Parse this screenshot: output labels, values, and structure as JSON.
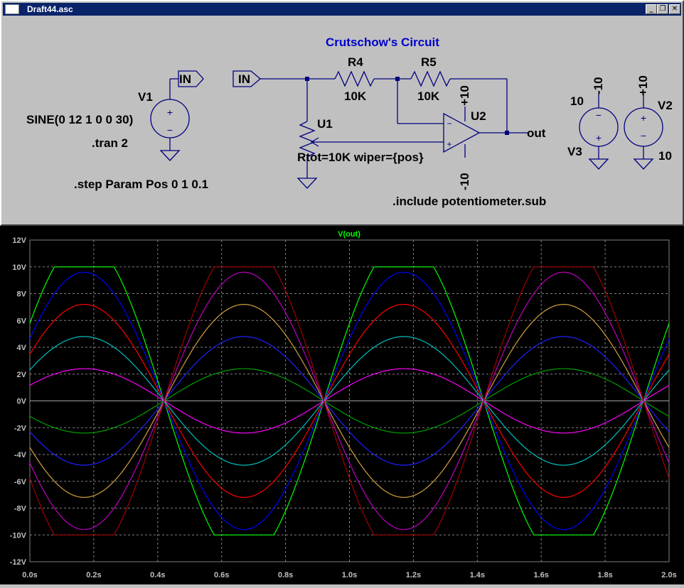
{
  "window": {
    "title": "Draft44.asc",
    "minimize_glyph": "_",
    "restore_glyph": "❐",
    "close_glyph": "✕"
  },
  "schematic": {
    "heading": "Crutschow's Circuit",
    "v1_label": "V1",
    "v1_value": "SINE(0 12 1 0 0 30)",
    "tran": ".tran 2",
    "step": ".step Param Pos 0 1 0.1",
    "in_label_1": "IN",
    "in_label_2": "IN",
    "r4_label": "R4",
    "r4_value": "10K",
    "r5_label": "R5",
    "r5_value": "10K",
    "u1_label": "U1",
    "u1_params": "Rtot=10K wiper={pos}",
    "u2_label": "U2",
    "opamp_plus_supply": "+10",
    "opamp_minus_supply": "-10",
    "opamp_minus_pin": "−",
    "opamp_plus_pin": "+",
    "out_label": "out",
    "include": ".include potentiometer.sub",
    "v3_label": "V3",
    "v3_value": "10",
    "v3_node": "-10",
    "v2_label": "V2",
    "v2_value": "10",
    "v2_node": "+10",
    "src_plus": "+",
    "src_minus": "−"
  },
  "colors": {
    "wire": "#000080",
    "component": "#000080",
    "heading": "#0000cc",
    "plot_bg": "#000000",
    "grid": "#808080",
    "trace_title": "#00ff00"
  },
  "chart_data": {
    "type": "line",
    "title": "V(out)",
    "xlabel": "",
    "ylabel": "",
    "xlim": [
      0,
      2
    ],
    "ylim": [
      -12,
      12
    ],
    "x_ticks": [
      "0.0s",
      "0.2s",
      "0.4s",
      "0.6s",
      "0.8s",
      "1.0s",
      "1.2s",
      "1.4s",
      "1.6s",
      "1.8s",
      "2.0s"
    ],
    "y_ticks": [
      "12V",
      "10V",
      "8V",
      "6V",
      "4V",
      "2V",
      "0V",
      "-2V",
      "-4V",
      "-6V",
      "-8V",
      "-10V",
      "-12V"
    ],
    "grid": true,
    "waveform": "sine",
    "frequency_hz": 1,
    "phase_zero_crossing_s": 0.42,
    "clip_limit_v": 10,
    "series": [
      {
        "amplitude": 12.0,
        "color": "#00ff00"
      },
      {
        "amplitude": 9.6,
        "color": "#0000ff"
      },
      {
        "amplitude": 7.2,
        "color": "#ff0000"
      },
      {
        "amplitude": 4.8,
        "color": "#00c0c0"
      },
      {
        "amplitude": 2.4,
        "color": "#ff00ff"
      },
      {
        "amplitude": -2.4,
        "color": "#00a000"
      },
      {
        "amplitude": -4.8,
        "color": "#2020ff"
      },
      {
        "amplitude": -7.2,
        "color": "#d0a040"
      },
      {
        "amplitude": -9.6,
        "color": "#c000c0"
      },
      {
        "amplitude": -12.0,
        "color": "#a00000"
      }
    ]
  }
}
